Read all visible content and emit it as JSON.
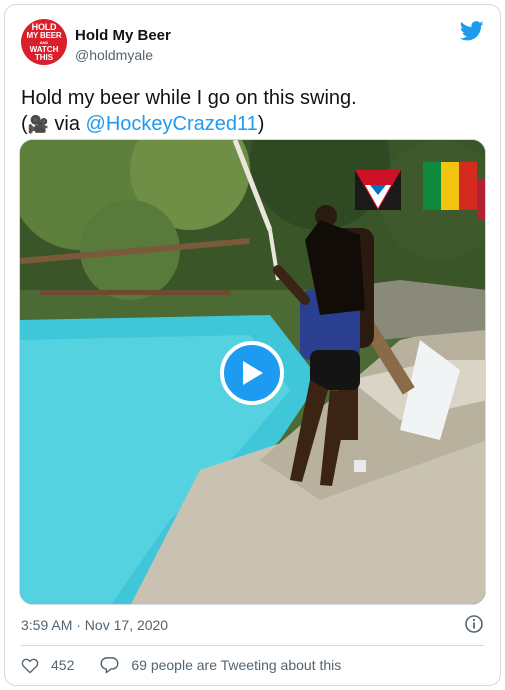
{
  "account": {
    "avatar_lines": [
      "HOLD",
      "MY BEER",
      "AND",
      "WATCH",
      "THIS"
    ],
    "display_name": "Hold My Beer",
    "handle": "@holdmyale"
  },
  "tweet": {
    "text_line1": "Hold my beer while I go on this swing.",
    "text_prefix": "(",
    "camera_emoji": "🎥",
    "via": " via ",
    "mention": "@HockeyCrazed11",
    "text_suffix": ")"
  },
  "media": {
    "type": "video",
    "play_icon": "play-icon"
  },
  "meta": {
    "timestamp": "3:59 AM · Nov 17, 2020"
  },
  "actions": {
    "like_count": "452",
    "conversation_label": "69 people are Tweeting about this"
  },
  "colors": {
    "accent": "#1d9bf0",
    "avatar_bg": "#d8202c",
    "muted": "#536471",
    "border": "#cfd9de"
  }
}
